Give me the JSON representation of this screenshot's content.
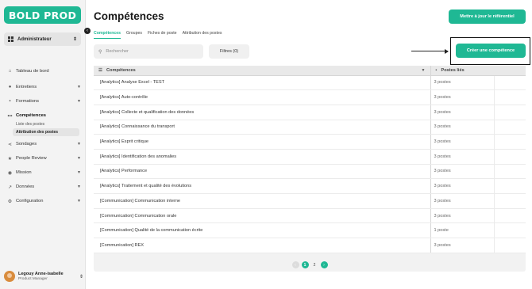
{
  "app": {
    "logo": "BOLD PROD",
    "collapse_icon": "chevron-left-icon"
  },
  "sidebar": {
    "role": "Administrateur",
    "items": [
      {
        "label": "Tableau de bord",
        "icon": "home-icon",
        "glyph": "⌂",
        "chevron": false
      },
      {
        "label": "Entretiens",
        "icon": "chat-icon",
        "glyph": "●",
        "chevron": true
      },
      {
        "label": "Formations",
        "icon": "briefcase-icon",
        "glyph": "▪",
        "chevron": true
      },
      {
        "label": "Compétences",
        "icon": "dumbbell-icon",
        "glyph": "⊷",
        "chevron": false,
        "active": true
      },
      {
        "label": "Sondages",
        "icon": "share-icon",
        "glyph": "⋖",
        "chevron": true
      },
      {
        "label": "People Review",
        "icon": "star-icon",
        "glyph": "★",
        "chevron": true
      },
      {
        "label": "Mission",
        "icon": "compass-icon",
        "glyph": "◉",
        "chevron": true
      },
      {
        "label": "Données",
        "icon": "chart-line-icon",
        "glyph": "↗",
        "chevron": true
      },
      {
        "label": "Configuration",
        "icon": "gear-icon",
        "glyph": "⚙",
        "chevron": true
      }
    ],
    "subitems": [
      {
        "label": "Liste des postes"
      },
      {
        "label": "Attribution des postes",
        "active": true
      }
    ]
  },
  "user": {
    "name": "Legouy Anne-isabelle",
    "title": "Product Manager"
  },
  "header": {
    "title": "Compétences",
    "update_button": "Mettre à jour le référentiel"
  },
  "tabs": [
    {
      "label": "Compétences",
      "active": true
    },
    {
      "label": "Groupes"
    },
    {
      "label": "Fiches de poste"
    },
    {
      "label": "Attribution des postes"
    }
  ],
  "toolbar": {
    "search_placeholder": "Rechercher",
    "filters_label": "Filtres (0)",
    "create_button": "Créer une compétence"
  },
  "table": {
    "columns": [
      "Compétences",
      "Postes liés"
    ],
    "rows": [
      {
        "name": "[Analytics] Analyse Excel - TEST",
        "postes": "3 postes"
      },
      {
        "name": "[Analytics] Auto-contrôle",
        "postes": "3 postes"
      },
      {
        "name": "[Analytics] Collecte et qualification des données",
        "postes": "3 postes"
      },
      {
        "name": "[Analytics] Connaissance du transport",
        "postes": "3 postes"
      },
      {
        "name": "[Analytics] Esprit critique",
        "postes": "3 postes"
      },
      {
        "name": "[Analytics] Identification des anomalies",
        "postes": "3 postes"
      },
      {
        "name": "[Analytics] Performance",
        "postes": "3 postes"
      },
      {
        "name": "[Analytics] Traitement et qualité des évolutions",
        "postes": "3 postes"
      },
      {
        "name": "[Communication] Communication interne",
        "postes": "3 postes"
      },
      {
        "name": "[Communication] Communication orale",
        "postes": "3 postes"
      },
      {
        "name": "[Communication] Qualité de la communication écrite",
        "postes": "1 poste"
      },
      {
        "name": "[Communication] REX",
        "postes": "3 postes"
      }
    ]
  },
  "pagination": {
    "pages": [
      "1",
      "2"
    ],
    "current": "1"
  }
}
